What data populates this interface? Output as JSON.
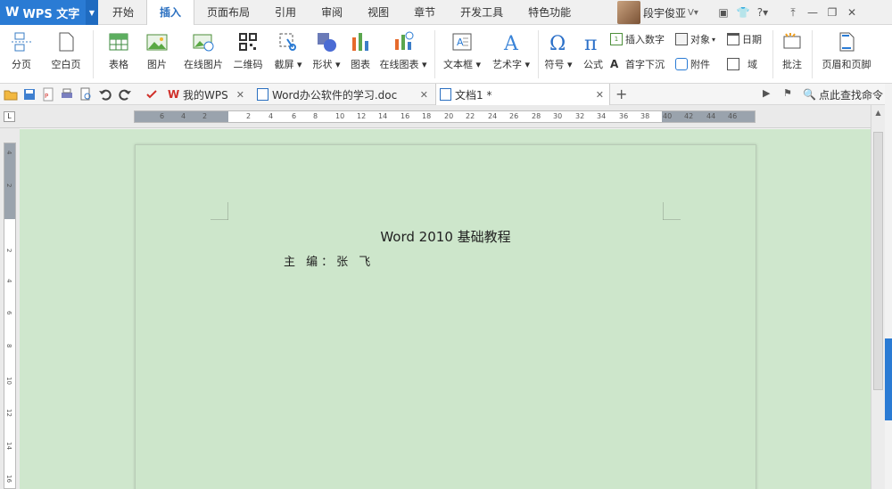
{
  "app": {
    "title": "WPS 文字"
  },
  "menu": {
    "tabs": [
      "开始",
      "插入",
      "页面布局",
      "引用",
      "审阅",
      "视图",
      "章节",
      "开发工具",
      "特色功能"
    ],
    "active": "插入"
  },
  "user": {
    "name": "段宇俊亚"
  },
  "ribbon": {
    "page_break": "分页",
    "blank_page": "空白页",
    "table": "表格",
    "picture": "图片",
    "online_picture": "在线图片",
    "qrcode": "二维码",
    "screenshot": "截屏",
    "shape": "形状",
    "chart": "图表",
    "online_chart": "在线图表",
    "textbox": "文本框",
    "wordart": "艺术字",
    "symbol": "符号",
    "formula": "公式",
    "insert_number": "插入数字",
    "object": "对象",
    "date": "日期",
    "drop_cap": "首字下沉",
    "attachment": "附件",
    "field": "域",
    "comment": "批注",
    "header_footer": "页眉和页脚"
  },
  "doc_tabs": [
    {
      "label": "我的WPS"
    },
    {
      "label": "Word办公软件的学习.doc"
    },
    {
      "label": "文档1 *"
    }
  ],
  "command_search": "点此查找命令",
  "ruler": {
    "h_ticks": [
      "6",
      "4",
      "2",
      "2",
      "4",
      "6",
      "8",
      "10",
      "12",
      "14",
      "16",
      "18",
      "20",
      "22",
      "24",
      "26",
      "28",
      "30",
      "32",
      "34",
      "36",
      "38",
      "40",
      "42",
      "44",
      "46"
    ],
    "v_ticks": [
      "4",
      "2",
      "2",
      "4",
      "6",
      "8",
      "10",
      "12",
      "14",
      "16"
    ]
  },
  "document": {
    "title": "Word 2010 基础教程",
    "editor": "主  编：张  飞"
  },
  "colors": {
    "accent": "#2a7bd4",
    "page_bg": "#cde6cb",
    "workspace": "#cfe7cd"
  }
}
